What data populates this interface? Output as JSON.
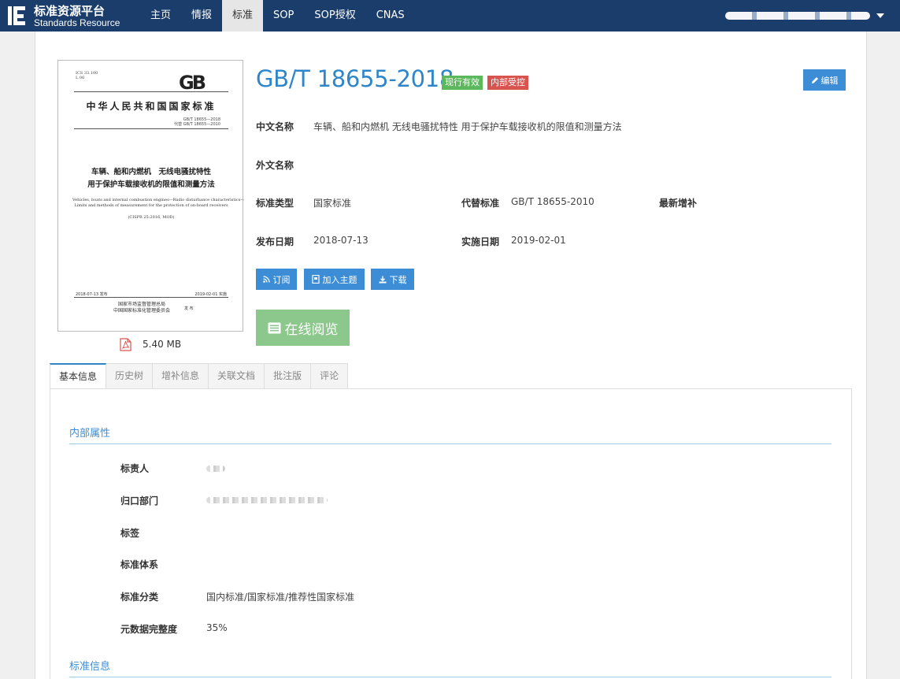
{
  "brand": {
    "name_cn": "标准资源平台",
    "name_en": "Standards Resource"
  },
  "nav": {
    "items": [
      {
        "label": "主页",
        "active": false
      },
      {
        "label": "情报",
        "active": false
      },
      {
        "label": "标准",
        "active": true
      },
      {
        "label": "SOP",
        "active": false
      },
      {
        "label": "SOP授权",
        "active": false
      },
      {
        "label": "CNAS",
        "active": false
      }
    ]
  },
  "cover": {
    "ics": "ICS 33.100\nL 06",
    "gb_mark": "GB",
    "nation": "中华人民共和国国家标准",
    "std_no": "GB/T 18655—2018\n代替 GB/T 18655—2010",
    "title_cn": "车辆、船和内燃机　无线电骚扰特性\n用于保护车载接收机的限值和测量方法",
    "title_en": "Vehicles, boats and internal combustion engines—Radio disturbance characteristics—\nLimits and methods of measurement for the protection of on-board receivers",
    "mod": "(CISPR 25:2016, MOD)",
    "publish": "2018-07-13 发布",
    "implement": "2019-02-01 实施",
    "issuer": "国家市场监督管理总局\n中国国家标准化管理委员会",
    "issuer_suffix": "发 布"
  },
  "file": {
    "size": "5.40 MB",
    "icon": "pdf-icon"
  },
  "standard": {
    "code": "GB/T 18655-2018",
    "badges": [
      {
        "label": "现行有效",
        "color": "#5cb85c"
      },
      {
        "label": "内部受控",
        "color": "#d9534f"
      }
    ],
    "edit_label": "编辑",
    "fields": {
      "cn_name_label": "中文名称",
      "cn_name": "车辆、船和内燃机 无线电骚扰特性 用于保护车载接收机的限值和测量方法",
      "foreign_name_label": "外文名称",
      "type_label": "标准类型",
      "type": "国家标准",
      "replaces_label": "代替标准",
      "replaces": "GB/T 18655-2010",
      "latest_label": "最新增补",
      "publish_label": "发布日期",
      "publish": "2018-07-13",
      "implement_label": "实施日期",
      "implement": "2019-02-01"
    }
  },
  "actions": {
    "subscribe": "订阅",
    "add_topic": "加入主题",
    "download": "下载",
    "read_online": "在线阅览"
  },
  "tabs": [
    {
      "label": "基本信息",
      "active": true
    },
    {
      "label": "历史树",
      "active": false
    },
    {
      "label": "增补信息",
      "active": false
    },
    {
      "label": "关联文档",
      "active": false
    },
    {
      "label": "批注版",
      "active": false
    },
    {
      "label": "评论",
      "active": false
    }
  ],
  "internal": {
    "title": "内部属性",
    "rows": [
      {
        "label": "标责人",
        "value": ""
      },
      {
        "label": "归口部门",
        "value": ""
      },
      {
        "label": "标签",
        "value": ""
      },
      {
        "label": "标准体系",
        "value": ""
      },
      {
        "label": "标准分类",
        "value": "国内标准/国家标准/推荐性国家标准"
      },
      {
        "label": "元数据完整度",
        "value": "35%"
      }
    ]
  },
  "std_info": {
    "title": "标准信息"
  }
}
